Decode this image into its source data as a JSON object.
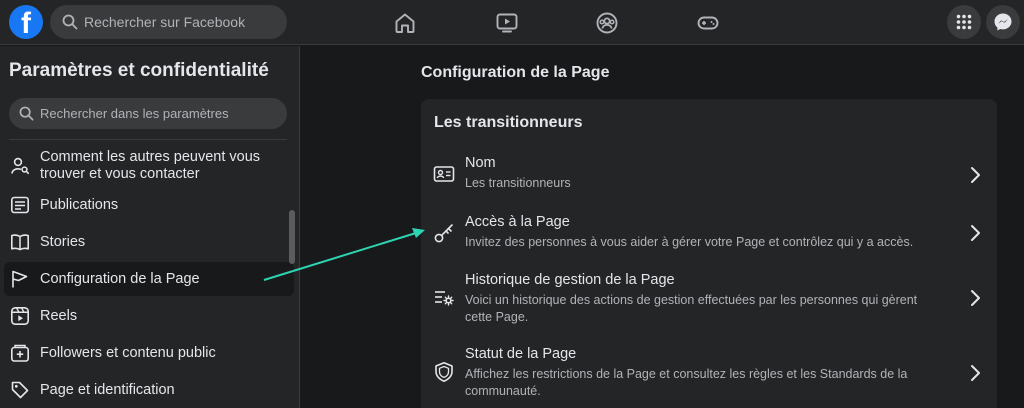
{
  "topbar": {
    "logo_letter": "f",
    "search_placeholder": "Rechercher sur Facebook",
    "nav_icons": [
      "home-icon",
      "video-icon",
      "groups-icon",
      "gaming-icon"
    ],
    "right_icons": [
      "menu-grid-icon",
      "messenger-icon"
    ]
  },
  "sidebar": {
    "title": "Paramètres et confidentialité",
    "search_placeholder": "Rechercher dans les paramètres",
    "items": [
      {
        "label": "Comment les autres peuvent vous trouver et vous contacter",
        "icon": "person-search-icon"
      },
      {
        "label": "Publications",
        "icon": "publications-icon"
      },
      {
        "label": "Stories",
        "icon": "book-icon"
      },
      {
        "label": "Configuration de la Page",
        "icon": "flag-icon"
      },
      {
        "label": "Reels",
        "icon": "reels-icon"
      },
      {
        "label": "Followers et contenu public",
        "icon": "followers-icon"
      },
      {
        "label": "Page et identification",
        "icon": "tag-icon"
      }
    ]
  },
  "main": {
    "title": "Configuration de la Page",
    "card": {
      "title": "Les transitionneurs",
      "rows": [
        {
          "title": "Nom",
          "desc": "Les transitionneurs",
          "icon": "id-card-icon"
        },
        {
          "title": "Accès à la Page",
          "desc": "Invitez des personnes à vous aider à gérer votre Page et contrôlez qui y a accès.",
          "icon": "key-icon"
        },
        {
          "title": "Historique de gestion de la Page",
          "desc": "Voici un historique des actions de gestion effectuées par les personnes qui gèrent cette Page.",
          "icon": "list-settings-icon"
        },
        {
          "title": "Statut de la Page",
          "desc": "Affichez les restrictions de la Page et consultez les règles et les Standards de la communauté.",
          "icon": "shield-icon"
        }
      ]
    }
  },
  "colors": {
    "background": "#18191a",
    "surface": "#242526",
    "brand": "#1877f2",
    "annotation_arrow": "#2ed3b2"
  }
}
